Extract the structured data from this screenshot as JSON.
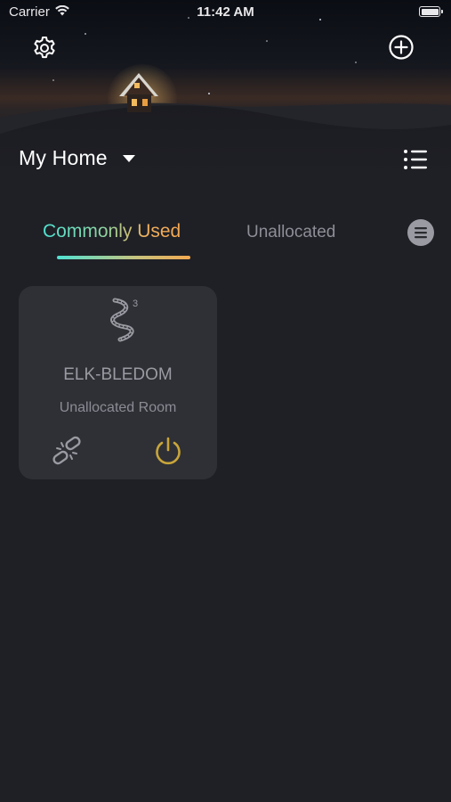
{
  "status_bar": {
    "carrier": "Carrier",
    "time": "11:42 AM"
  },
  "header": {
    "settings_icon": "gear-icon",
    "add_icon": "plus-circle-icon",
    "home_name": "My Home",
    "list_icon": "list-icon"
  },
  "tabs": {
    "items": [
      {
        "label": "Commonly Used",
        "active": true
      },
      {
        "label": "Unallocated",
        "active": false
      }
    ],
    "more_icon": "menu-circle-icon"
  },
  "devices": [
    {
      "name": "ELK-BLEDOM",
      "room": "Unallocated Room",
      "icon": "led-strip-icon",
      "badge": "3",
      "power_on": true
    }
  ],
  "colors": {
    "background": "#1f2026",
    "card": "#2f3036",
    "accent_teal": "#4fe2d2",
    "accent_orange": "#f2a950",
    "power": "#c8a53a",
    "muted_text": "#8d8e96"
  }
}
